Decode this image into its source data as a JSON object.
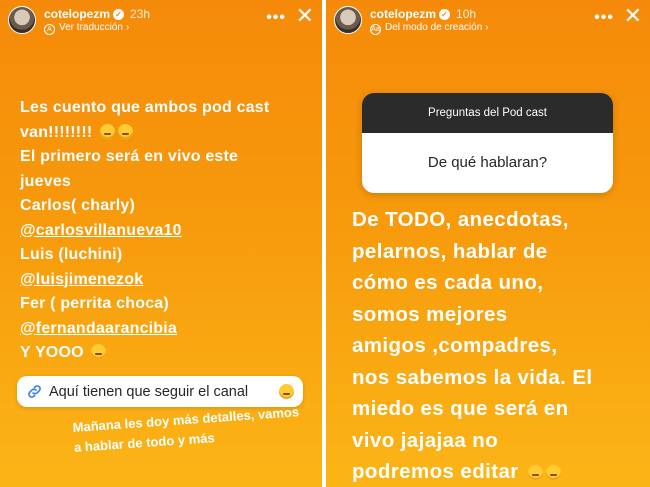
{
  "left_story": {
    "username": "cotelopezm",
    "time": "23h",
    "subtitle": "Ver traducción",
    "lines": [
      "Les cuento que ambos pod cast",
      "van!!!!!!!!",
      "El primero será en vivo este",
      "jueves",
      "Carlos( charly)",
      "@carlosvillanueva10",
      "Luis (luchini)",
      "@luisjimenezok",
      "Fer ( perrita choca)",
      "@fernandaarancibia",
      "Y YOOO"
    ],
    "channel_sticker": "Aquí tienen que seguir el canal",
    "bottom_note": "Mañana les doy más detalles, vamos a hablar de todo y más"
  },
  "right_story": {
    "username": "cotelopezm",
    "time": "10h",
    "subtitle": "Del modo de creación",
    "question_title": "Preguntas del Pod cast",
    "question_text": "De qué hablaran?",
    "answer_lines": [
      "De TODO, anecdotas,",
      "pelarnos, hablar de",
      "cómo es cada uno,",
      "somos mejores",
      "amigos ,compadres,",
      "nos sabemos la vida. El",
      "miedo es que será en",
      "vivo jajajaa no",
      "podremos editar"
    ]
  },
  "icons": [
    "verified-badge-icon",
    "translate-icon",
    "create-mode-icon",
    "more-options-icon",
    "close-icon",
    "link-icon",
    "emoji-icon"
  ],
  "colors": {
    "story_gradient_top": "#f58a0a",
    "story_gradient_bottom": "#fbb517",
    "question_header": "#2b2b2b"
  }
}
